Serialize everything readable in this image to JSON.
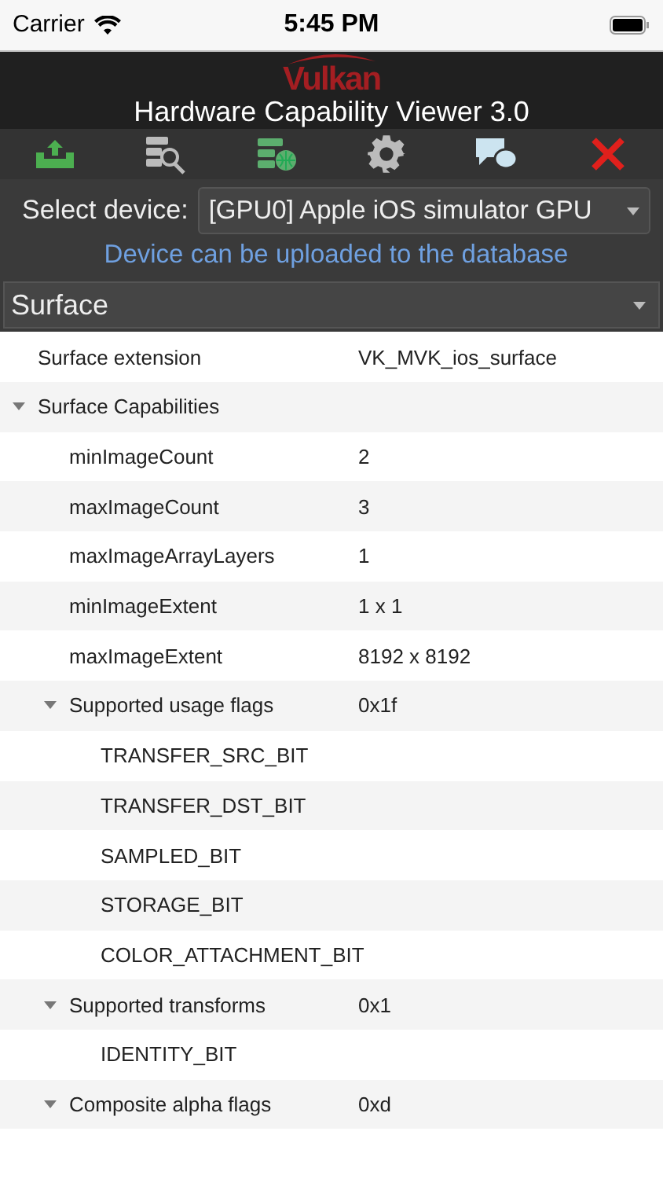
{
  "status_bar": {
    "carrier": "Carrier",
    "time": "5:45 PM"
  },
  "header": {
    "logo": "Vulkan",
    "title": "Hardware Capability Viewer 3.0"
  },
  "device": {
    "label": "Select device:",
    "value": "[GPU0] Apple iOS simulator GPU",
    "notice": "Device can be uploaded to the database"
  },
  "category": {
    "value": "Surface"
  },
  "tree": [
    {
      "label": "Surface extension",
      "value": "VK_MVK_ios_surface"
    },
    {
      "label": "Surface Capabilities",
      "expanded": true,
      "children": [
        {
          "label": "minImageCount",
          "value": "2"
        },
        {
          "label": "maxImageCount",
          "value": "3"
        },
        {
          "label": "maxImageArrayLayers",
          "value": "1"
        },
        {
          "label": "minImageExtent",
          "value": "1 x 1"
        },
        {
          "label": "maxImageExtent",
          "value": "8192 x 8192"
        },
        {
          "label": "Supported usage flags",
          "value": "0x1f",
          "expanded": true,
          "children": [
            {
              "label": "TRANSFER_SRC_BIT"
            },
            {
              "label": "TRANSFER_DST_BIT"
            },
            {
              "label": "SAMPLED_BIT"
            },
            {
              "label": "STORAGE_BIT"
            },
            {
              "label": "COLOR_ATTACHMENT_BIT"
            }
          ]
        },
        {
          "label": "Supported transforms",
          "value": "0x1",
          "expanded": true,
          "children": [
            {
              "label": "IDENTITY_BIT"
            }
          ]
        },
        {
          "label": "Composite alpha flags",
          "value": "0xd",
          "expanded": true
        }
      ]
    }
  ]
}
